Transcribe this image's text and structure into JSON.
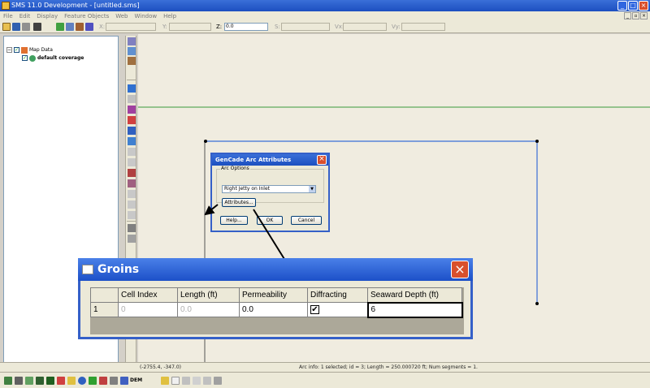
{
  "window": {
    "title": "SMS 11.0 Development - [untitled.sms]"
  },
  "menu": [
    "File",
    "Edit",
    "Display",
    "Feature Objects",
    "Web",
    "Window",
    "Help"
  ],
  "toolbar": {
    "x_label": "X:",
    "y_label": "Y:",
    "z_label": "Z:",
    "z_value": "0.0",
    "s_label": "S:",
    "vx_label": "Vx:",
    "vy_label": "Vy:"
  },
  "tree": {
    "root_label": "Map Data",
    "child_label": "default coverage"
  },
  "arc_dialog": {
    "title": "GenCade Arc Attributes",
    "group_label": "Arc Options",
    "selected_option": "Right Jetty on Inlet",
    "attributes_button": "Attributes...",
    "help_button": "Help...",
    "ok_button": "OK",
    "cancel_button": "Cancel"
  },
  "groins_dialog": {
    "title": "Groins",
    "columns": [
      "Cell Index",
      "Length (ft)",
      "Permeability",
      "Diffracting",
      "Seaward Depth (ft)"
    ],
    "row": {
      "index": "1",
      "cell_index": "0",
      "length": "0.0",
      "permeability": "0.0",
      "diffracting_checked": "✔",
      "seaward_depth": "6"
    }
  },
  "status": {
    "cursor_coords": "(-2755.4, -347.0)",
    "arc_info": "Arc info: 1 selected; id = 3; Length = 250.000720 ft; Num segments = 1."
  },
  "bottom_toolbar": {
    "dem_label": "DEM"
  },
  "colors": {
    "arc_blue": "#3b6fd6",
    "grid_line_green": "#3a9a3a",
    "title_blue": "#1c4fc0"
  },
  "icons": [
    "app-icon",
    "minimize-icon",
    "maximize-icon",
    "close-icon",
    "new-icon",
    "open-icon",
    "save-icon",
    "print-icon",
    "delete-icon",
    "zoom-icon",
    "pan-icon",
    "rotate-icon",
    "select-arc-icon",
    "create-arc-icon",
    "vertex-icon",
    "checkbox-checked-icon",
    "dropdown-arrow-icon"
  ]
}
